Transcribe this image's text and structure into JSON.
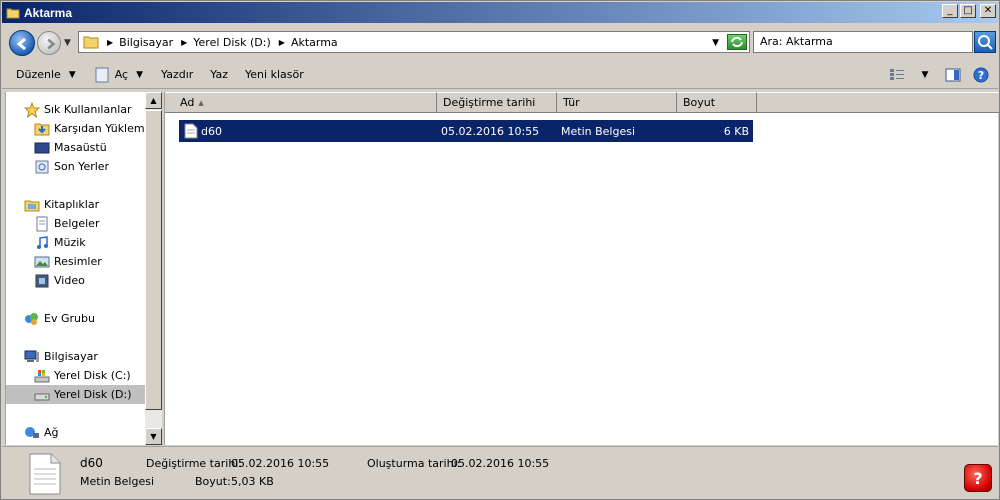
{
  "window": {
    "title": "Aktarma"
  },
  "address": {
    "breadcrumbs": [
      "Bilgisayar",
      "Yerel Disk (D:)",
      "Aktarma"
    ],
    "search_placeholder": "Ara: Aktarma"
  },
  "toolbar": {
    "organize": "Düzenle",
    "open": "Aç",
    "print": "Yazdır",
    "write": "Yaz",
    "new_folder": "Yeni klasör"
  },
  "nav": {
    "favorites": "Sık Kullanılanlar",
    "downloads": "Karşıdan Yüklemeler",
    "desktop": "Masaüstü",
    "recent": "Son Yerler",
    "libraries": "Kitaplıklar",
    "documents": "Belgeler",
    "music": "Müzik",
    "pictures": "Resimler",
    "video": "Video",
    "homegroup": "Ev Grubu",
    "computer": "Bilgisayar",
    "disk_c": "Yerel Disk (C:)",
    "disk_d": "Yerel Disk (D:)",
    "network": "Ağ"
  },
  "columns": {
    "name": "Ad",
    "modified": "Değiştirme tarihi",
    "type": "Tür",
    "size": "Boyut"
  },
  "files": [
    {
      "name": "d60",
      "modified": "05.02.2016 10:55",
      "type": "Metin Belgesi",
      "size": "6 KB"
    }
  ],
  "details": {
    "name": "d60",
    "type": "Metin Belgesi",
    "modified_label": "Değiştirme tarihi:",
    "modified_value": "05.02.2016 10:55",
    "size_label": "Boyut:",
    "size_value": "5,03 KB",
    "created_label": "Oluşturma tarihi:",
    "created_value": "05.02.2016 10:55"
  },
  "colors": {
    "selection": "#0a246a",
    "titlebar": "#0a246a"
  },
  "icons": [
    "folder-icon",
    "back-icon",
    "forward-icon",
    "refresh-icon",
    "search-icon",
    "text-file-icon",
    "help-icon"
  ]
}
